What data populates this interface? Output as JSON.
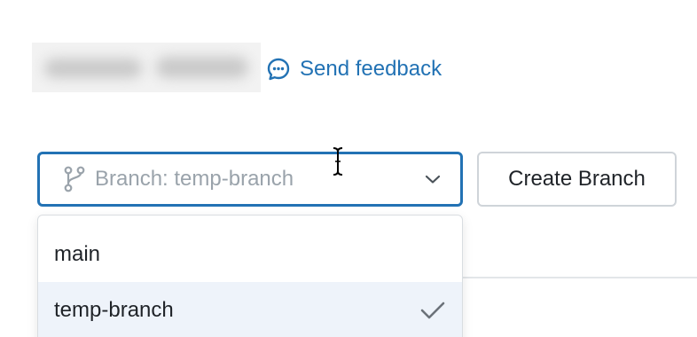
{
  "feedback": {
    "label": "Send feedback",
    "icon": "chat-bubble-icon",
    "color": "#2272b4"
  },
  "branch_select": {
    "placeholder": "Branch: temp-branch",
    "icon": "git-branch-icon",
    "chevron": "chevron-down-icon",
    "border_color": "#2272b4"
  },
  "create_branch": {
    "label": "Create Branch"
  },
  "dropdown": {
    "options": [
      {
        "label": "main",
        "selected": false
      },
      {
        "label": "temp-branch",
        "selected": true
      }
    ],
    "selected_check_icon": "check-icon",
    "highlight_color": "#eef3fa"
  }
}
